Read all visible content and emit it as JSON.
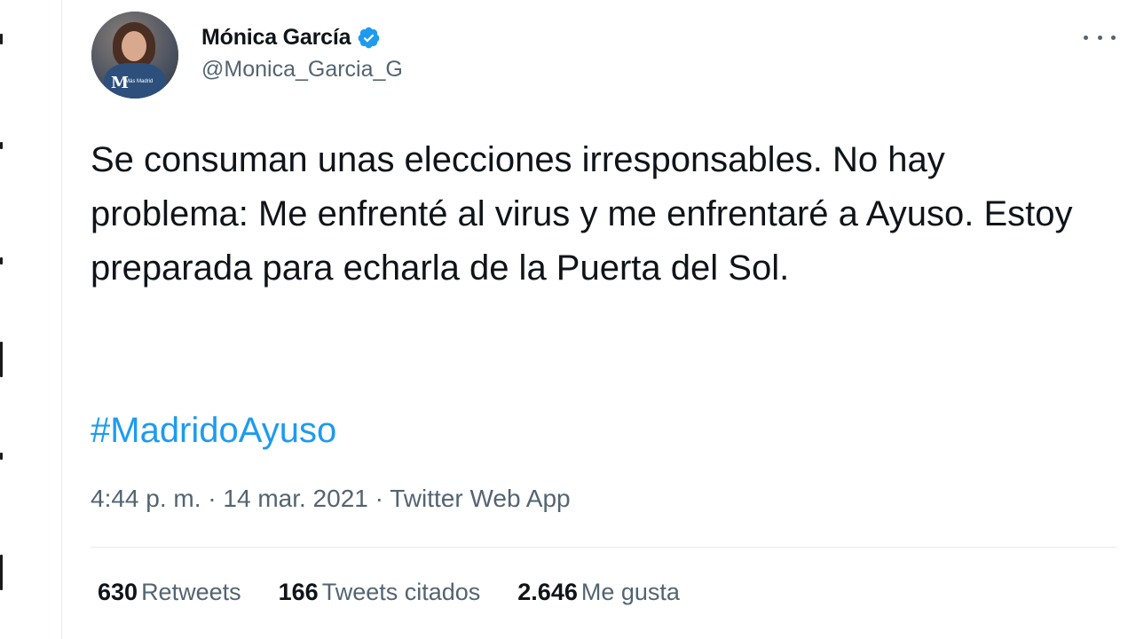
{
  "tweet": {
    "author": {
      "display_name": "Mónica García",
      "handle": "@Monica_Garcia_G",
      "verified": true,
      "avatar_badge_letter": "M",
      "avatar_badge_text": "Más Madrid"
    },
    "text": "Se consuman unas elecciones irresponsables. No hay problema: Me enfrenté al virus y me enfrentaré a Ayuso. Estoy preparada para echarla de la Puerta del Sol.",
    "hashtag": "#MadridoAyuso",
    "timestamp": "4:44 p. m. · 14 mar. 2021",
    "separator": " · ",
    "source": "Twitter Web App",
    "stats": [
      {
        "count": "630",
        "label": "Retweets"
      },
      {
        "count": "166",
        "label": "Tweets citados"
      },
      {
        "count": "2.646",
        "label": "Me gusta"
      }
    ],
    "more_icon": "more-options-icon"
  },
  "colors": {
    "text": "#0f1419",
    "secondary": "#536471",
    "link": "#1d9bf0",
    "verified": "#1d9bf0",
    "border": "#e6ecf0"
  }
}
